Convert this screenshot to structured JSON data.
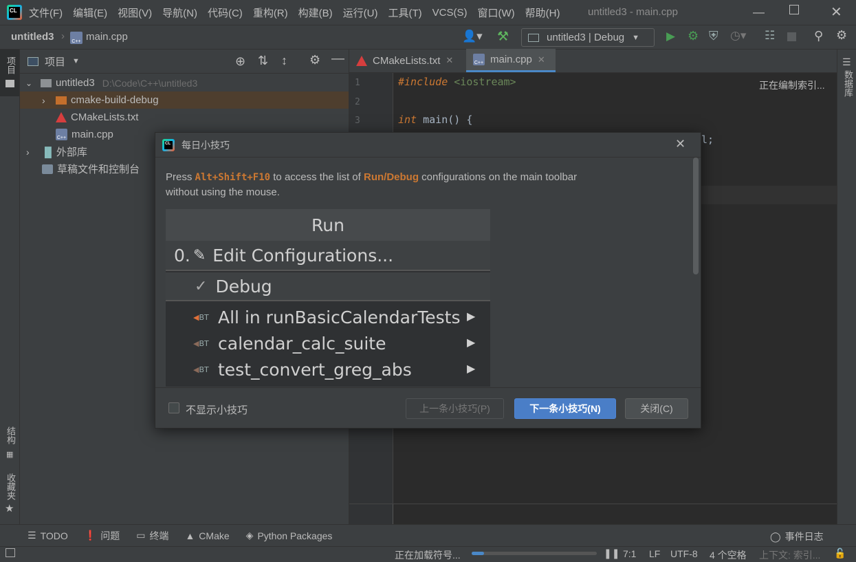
{
  "menubar": {
    "app_logo": "CL",
    "items": [
      "文件(F)",
      "编辑(E)",
      "视图(V)",
      "导航(N)",
      "代码(C)",
      "重构(R)",
      "构建(B)",
      "运行(U)",
      "工具(T)",
      "VCS(S)",
      "窗口(W)",
      "帮助(H)"
    ],
    "window_title": "untitled3 - main.cpp"
  },
  "navbar": {
    "project": "untitled3",
    "file": "main.cpp",
    "run_config": "untitled3 | Debug"
  },
  "left_strip": {
    "project_label": "项目",
    "structure_label": "结构",
    "favorites_label": "收藏夹"
  },
  "right_strip": {
    "database_label": "数据库"
  },
  "project_panel": {
    "header": "项目",
    "tree": [
      {
        "label": "untitled3",
        "hint": "D:\\Code\\C++\\untitled3"
      },
      {
        "label": "cmake-build-debug"
      },
      {
        "label": "CMakeLists.txt"
      },
      {
        "label": "main.cpp"
      },
      {
        "label": "外部库"
      },
      {
        "label": "草稿文件和控制台"
      }
    ]
  },
  "editor": {
    "tabs": [
      "CMakeLists.txt",
      "main.cpp"
    ],
    "lines": [
      "1",
      "2",
      "3"
    ],
    "code": {
      "include_kw": "#include",
      "include_arg": "<iostream>",
      "int_kw": "int",
      "main_sig": "main() {",
      "line4_tail": "l;"
    },
    "indexing": "正在编制索引..."
  },
  "dialog": {
    "title": "每日小技巧",
    "text_pre": "Press ",
    "shortcut": "Alt+Shift+F10",
    "text_mid": " to access the list of ",
    "highlight": "Run/Debug",
    "text_post": " configurations on the main toolbar",
    "text_line2": "without using the mouse.",
    "demo": {
      "header": "Run",
      "edit_prefix": "0.",
      "edit_label": "Edit Configurations...",
      "debug_label": "Debug",
      "items": [
        "All in runBasicCalendarTests",
        "calendar_calc_suite",
        "test_convert_greg_abs"
      ],
      "bt_badge": "BT"
    },
    "checkbox_label": "不显示小技巧",
    "prev_button": "上一条小技巧(P)",
    "next_button": "下一条小技巧(N)",
    "close_button": "关闭(C)"
  },
  "bottom_tools": [
    "TODO",
    "问题",
    "终端",
    "CMake",
    "Python Packages"
  ],
  "event_log": "事件日志",
  "statusbar": {
    "loading": "正在加载符号...",
    "progress": 0.1,
    "position": "7:1",
    "line_sep": "LF",
    "encoding": "UTF-8",
    "indent": "4 个空格",
    "context": "上下文: 索引..."
  },
  "colors": {
    "accent": "#4a88c7",
    "primary_button": "#365880",
    "orange": "#cc7832",
    "keyword": "#cc7832",
    "string_green": "#6a8759",
    "run_green": "#499c54"
  }
}
